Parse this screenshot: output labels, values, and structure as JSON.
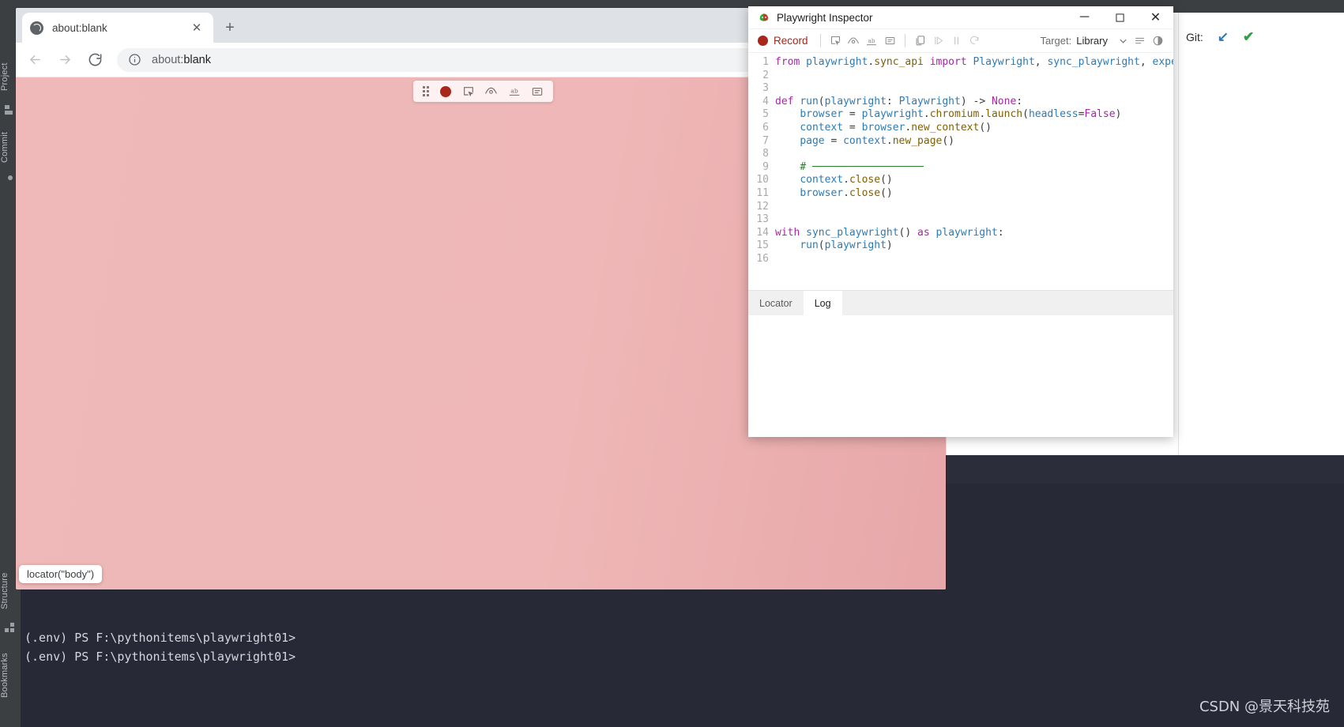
{
  "ide": {
    "rail_labels": [
      "Project",
      "Commit",
      "Structure",
      "Bookmarks"
    ],
    "git_label": "Git:",
    "git_update_glyph": "↙",
    "git_check_glyph": "✔",
    "git_update_color": "#2b7bb9",
    "git_check_color": "#2ea043"
  },
  "terminal": {
    "lines": [
      "(.env) PS F:\\pythonitems\\playwright01>",
      "(.env) PS F:\\pythonitems\\playwright01>"
    ],
    "watermark": "CSDN @景天科技苑"
  },
  "browser": {
    "tab": {
      "title": "about:blank",
      "favicon_name": "globe-icon",
      "close_label": "✕"
    },
    "new_tab_label": "+",
    "nav": {
      "back_label": "←",
      "forward_label": "→",
      "reload_label": "⟳"
    },
    "omnibox": {
      "url": "about:blank",
      "scheme": "about:",
      "rest": "blank",
      "site_info_icon": "info-circle-icon"
    },
    "viewport": {
      "background_color": "#efb9b9"
    },
    "locator_tooltip": "locator(\"body\")",
    "page_toolbar": {
      "buttons": [
        {
          "name": "drag-handle-icon",
          "label": ""
        },
        {
          "name": "record-icon",
          "label": ""
        },
        {
          "name": "pick-locator-icon",
          "label": ""
        },
        {
          "name": "assert-visibility-icon",
          "label": ""
        },
        {
          "name": "assert-text-icon",
          "label": "ab"
        },
        {
          "name": "assert-value-icon",
          "label": ""
        }
      ]
    }
  },
  "inspector": {
    "title": "Playwright Inspector",
    "window_controls": {
      "minimize": "─",
      "maximize": "☐",
      "close": "✕"
    },
    "toolbar": {
      "record_label": "Record",
      "record_color": "#a8261b",
      "buttons": [
        {
          "name": "pick-locator-icon",
          "tooltip": "Pick locator"
        },
        {
          "name": "assert-visibility-icon",
          "tooltip": "Assert visibility"
        },
        {
          "name": "assert-text-icon",
          "tooltip": "Assert text"
        },
        {
          "name": "assert-value-icon",
          "tooltip": "Assert value"
        },
        {
          "name": "copy-icon",
          "tooltip": "Copy"
        },
        {
          "name": "resume-icon",
          "tooltip": "Resume"
        },
        {
          "name": "pause-icon",
          "tooltip": "Pause"
        },
        {
          "name": "step-over-icon",
          "tooltip": "Step over"
        }
      ],
      "target_label": "Target:",
      "target_value": "Library",
      "caret": "⌄",
      "right_icons": [
        {
          "name": "list-view-icon"
        },
        {
          "name": "theme-toggle-icon"
        }
      ]
    },
    "code": {
      "language": "python",
      "lines": [
        {
          "n": "1",
          "tokens": [
            {
              "t": "from ",
              "c": "k-kw"
            },
            {
              "t": "playwright",
              "c": "k-var"
            },
            {
              "t": ".",
              "c": "k-pun"
            },
            {
              "t": "sync_api",
              "c": "k-fn"
            },
            {
              "t": " ",
              "c": "k-pun"
            },
            {
              "t": "import",
              "c": "k-kw"
            },
            {
              "t": " ",
              "c": "k-pun"
            },
            {
              "t": "Playwright",
              "c": "k-cls"
            },
            {
              "t": ", ",
              "c": "k-pun"
            },
            {
              "t": "sync_playwright",
              "c": "k-cls"
            },
            {
              "t": ", ",
              "c": "k-pun"
            },
            {
              "t": "expect",
              "c": "k-cls"
            }
          ]
        },
        {
          "n": "2",
          "tokens": []
        },
        {
          "n": "3",
          "tokens": []
        },
        {
          "n": "4",
          "tokens": [
            {
              "t": "def ",
              "c": "k-kw"
            },
            {
              "t": "run",
              "c": "k-var"
            },
            {
              "t": "(",
              "c": "k-pun"
            },
            {
              "t": "playwright",
              "c": "k-param"
            },
            {
              "t": ": ",
              "c": "k-pun"
            },
            {
              "t": "Playwright",
              "c": "k-cls"
            },
            {
              "t": ") ",
              "c": "k-pun"
            },
            {
              "t": "-> ",
              "c": "k-pun"
            },
            {
              "t": "None",
              "c": "k-none"
            },
            {
              "t": ":",
              "c": "k-pun"
            }
          ]
        },
        {
          "n": "5",
          "tokens": [
            {
              "t": "    ",
              "c": "k-pun"
            },
            {
              "t": "browser",
              "c": "k-var"
            },
            {
              "t": " = ",
              "c": "k-pun"
            },
            {
              "t": "playwright",
              "c": "k-var"
            },
            {
              "t": ".",
              "c": "k-pun"
            },
            {
              "t": "chromium",
              "c": "k-fn"
            },
            {
              "t": ".",
              "c": "k-pun"
            },
            {
              "t": "launch",
              "c": "k-fn"
            },
            {
              "t": "(",
              "c": "k-pun"
            },
            {
              "t": "headless",
              "c": "k-param"
            },
            {
              "t": "=",
              "c": "k-pun"
            },
            {
              "t": "False",
              "c": "k-none"
            },
            {
              "t": ")",
              "c": "k-pun"
            }
          ]
        },
        {
          "n": "6",
          "tokens": [
            {
              "t": "    ",
              "c": "k-pun"
            },
            {
              "t": "context",
              "c": "k-var"
            },
            {
              "t": " = ",
              "c": "k-pun"
            },
            {
              "t": "browser",
              "c": "k-var"
            },
            {
              "t": ".",
              "c": "k-pun"
            },
            {
              "t": "new_context",
              "c": "k-fn"
            },
            {
              "t": "()",
              "c": "k-pun"
            }
          ]
        },
        {
          "n": "7",
          "tokens": [
            {
              "t": "    ",
              "c": "k-pun"
            },
            {
              "t": "page",
              "c": "k-var"
            },
            {
              "t": " = ",
              "c": "k-pun"
            },
            {
              "t": "context",
              "c": "k-var"
            },
            {
              "t": ".",
              "c": "k-pun"
            },
            {
              "t": "new_page",
              "c": "k-fn"
            },
            {
              "t": "()",
              "c": "k-pun"
            }
          ]
        },
        {
          "n": "8",
          "tokens": []
        },
        {
          "n": "9",
          "tokens": [
            {
              "t": "    ",
              "c": "k-pun"
            },
            {
              "t": "# ",
              "c": "k-cmt"
            },
            {
              "t": "──────────────────",
              "c": "k-cmt"
            }
          ]
        },
        {
          "n": "10",
          "tokens": [
            {
              "t": "    ",
              "c": "k-pun"
            },
            {
              "t": "context",
              "c": "k-var"
            },
            {
              "t": ".",
              "c": "k-pun"
            },
            {
              "t": "close",
              "c": "k-fn"
            },
            {
              "t": "()",
              "c": "k-pun"
            }
          ]
        },
        {
          "n": "11",
          "tokens": [
            {
              "t": "    ",
              "c": "k-pun"
            },
            {
              "t": "browser",
              "c": "k-var"
            },
            {
              "t": ".",
              "c": "k-pun"
            },
            {
              "t": "close",
              "c": "k-fn"
            },
            {
              "t": "()",
              "c": "k-pun"
            }
          ]
        },
        {
          "n": "12",
          "tokens": []
        },
        {
          "n": "13",
          "tokens": []
        },
        {
          "n": "14",
          "tokens": [
            {
              "t": "with ",
              "c": "k-kw"
            },
            {
              "t": "sync_playwright",
              "c": "k-var"
            },
            {
              "t": "() ",
              "c": "k-pun"
            },
            {
              "t": "as ",
              "c": "k-kw"
            },
            {
              "t": "playwright",
              "c": "k-var"
            },
            {
              "t": ":",
              "c": "k-pun"
            }
          ]
        },
        {
          "n": "15",
          "tokens": [
            {
              "t": "    ",
              "c": "k-pun"
            },
            {
              "t": "run",
              "c": "k-var"
            },
            {
              "t": "(",
              "c": "k-pun"
            },
            {
              "t": "playwright",
              "c": "k-var"
            },
            {
              "t": ")",
              "c": "k-pun"
            }
          ]
        },
        {
          "n": "16",
          "tokens": []
        }
      ]
    },
    "tabs": [
      {
        "label": "Locator",
        "active": false
      },
      {
        "label": "Log",
        "active": true
      }
    ]
  }
}
